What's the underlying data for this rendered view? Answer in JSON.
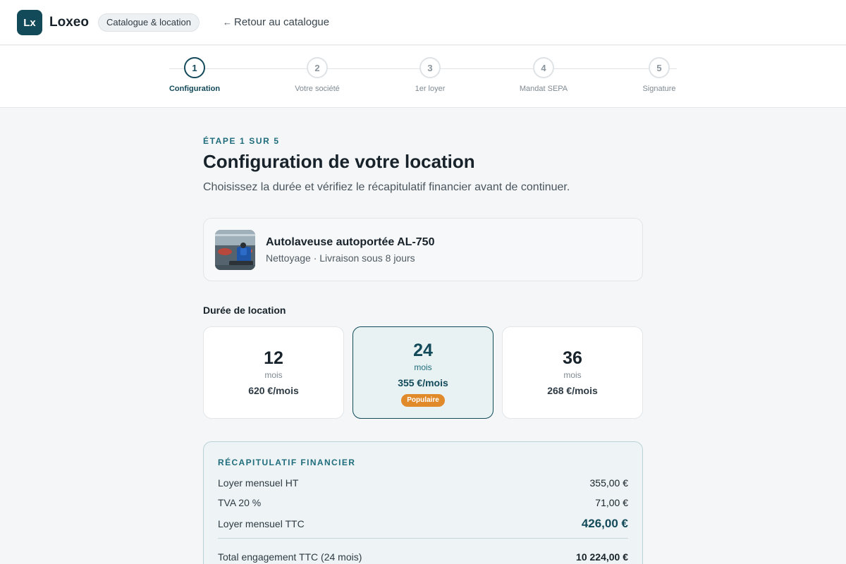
{
  "header": {
    "logo_text": "Lx",
    "brand": "Loxeo",
    "section_pill": "Catalogue & location",
    "back_arrow": "←",
    "back_label": "Retour au catalogue"
  },
  "stepper": {
    "steps": [
      {
        "number": "1",
        "label": "Configuration",
        "active": true
      },
      {
        "number": "2",
        "label": "Votre société",
        "active": false
      },
      {
        "number": "3",
        "label": "1er loyer",
        "active": false
      },
      {
        "number": "4",
        "label": "Mandat SEPA",
        "active": false
      },
      {
        "number": "5",
        "label": "Signature",
        "active": false
      }
    ]
  },
  "main": {
    "eyebrow": "ÉTAPE 1 SUR 5",
    "title": "Configuration de votre location",
    "subtitle": "Choisissez la durée et vérifiez le récapitulatif financier avant de continuer."
  },
  "product": {
    "name": "Autolaveuse autoportée AL-750",
    "meta": "Nettoyage · Livraison sous 8 jours"
  },
  "duration": {
    "label": "Durée de location",
    "options": [
      {
        "months": "12",
        "unit": "mois",
        "price": "620 €/mois",
        "selected": false,
        "badge": ""
      },
      {
        "months": "24",
        "unit": "mois",
        "price": "355 €/mois",
        "selected": true,
        "badge": "Populaire"
      },
      {
        "months": "36",
        "unit": "mois",
        "price": "268 €/mois",
        "selected": false,
        "badge": ""
      }
    ]
  },
  "recap": {
    "title": "RÉCAPITULATIF FINANCIER",
    "rows": [
      {
        "label": "Loyer mensuel HT",
        "value": "355,00 €"
      },
      {
        "label": "TVA 20 %",
        "value": "71,00 €"
      },
      {
        "label": "Loyer mensuel TTC",
        "value": "426,00 €"
      },
      {
        "label": "Total engagement TTC (24 mois)",
        "value": "10 224,00 €"
      }
    ]
  },
  "colors": {
    "brand": "#134a5a",
    "accent": "#1e6c7c",
    "badge": "#e08a2a"
  }
}
